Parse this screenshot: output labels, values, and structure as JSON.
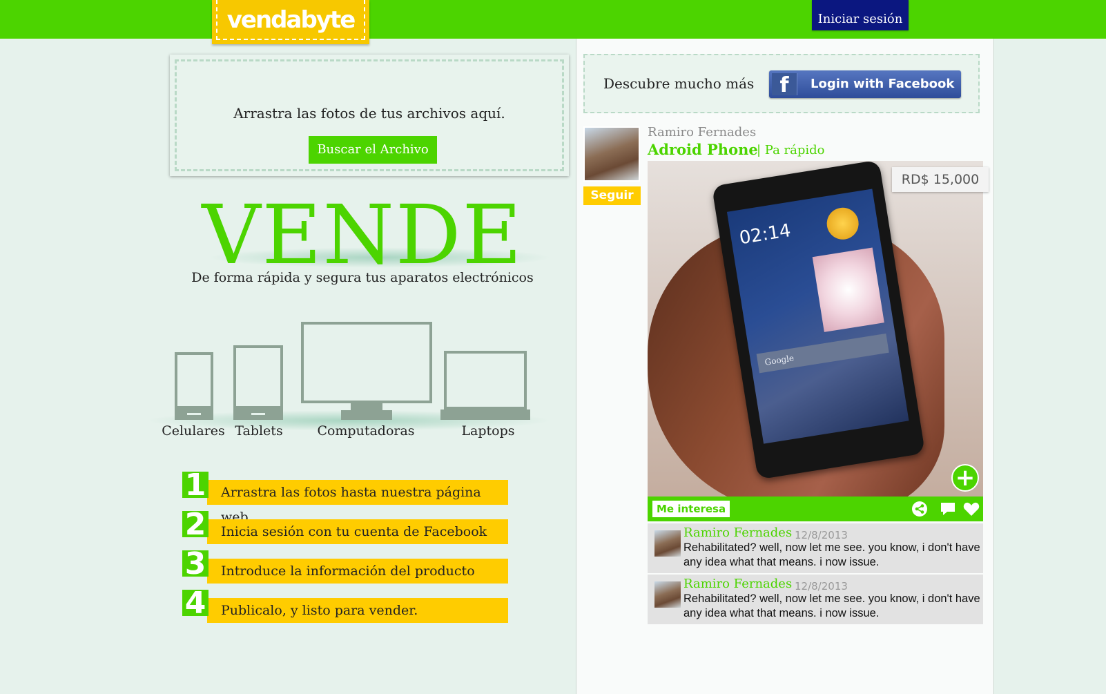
{
  "header": {
    "logo_text": "vendabyte",
    "login_label": "Iniciar sesión"
  },
  "upload": {
    "instruction": "Arrastra las fotos de tus archivos aquí.",
    "button_label": "Buscar el Archivo"
  },
  "hero": {
    "title": "VENDE",
    "tagline": "De forma rápida y segura tus aparatos electrónicos"
  },
  "devices": [
    "Celulares",
    "Tablets",
    "Computadoras",
    "Laptops"
  ],
  "steps": [
    {
      "number": "1",
      "label": "Arrastra las fotos hasta nuestra página web"
    },
    {
      "number": "2",
      "label": "Inicia sesión con tu cuenta de Facebook"
    },
    {
      "number": "3",
      "label": "Introduce la información del producto"
    },
    {
      "number": "4",
      "label": "Publicalo, y listo para vender."
    }
  ],
  "facebook": {
    "prompt": "Descubre mucho más",
    "button_label": "Login with Facebook"
  },
  "post": {
    "author": "Ramiro Fernades",
    "follow_label": "Seguir",
    "title": "Adroid Phone",
    "subtitle": "| Pa rápido",
    "price": "RD$ 15,000",
    "phone_time": "02:14",
    "phone_search": "Google",
    "interest_label": "Me interesa",
    "icons": [
      "share-icon",
      "comment-icon",
      "heart-icon"
    ]
  },
  "comments": [
    {
      "author": "Ramiro Fernades",
      "date": "12/8/2013",
      "text": "Rehabilitated? well, now let me see. you know, i don't have any idea what that means. i now issue."
    },
    {
      "author": "Ramiro Fernades",
      "date": "12/8/2013",
      "text": "Rehabilitated? well, now let me see. you know, i don't have any idea what that means. i now issue."
    }
  ],
  "colors": {
    "brand_green": "#4cd400",
    "brand_yellow": "#ffcc00",
    "navy": "#0b1780",
    "background": "#e6f2ec"
  }
}
